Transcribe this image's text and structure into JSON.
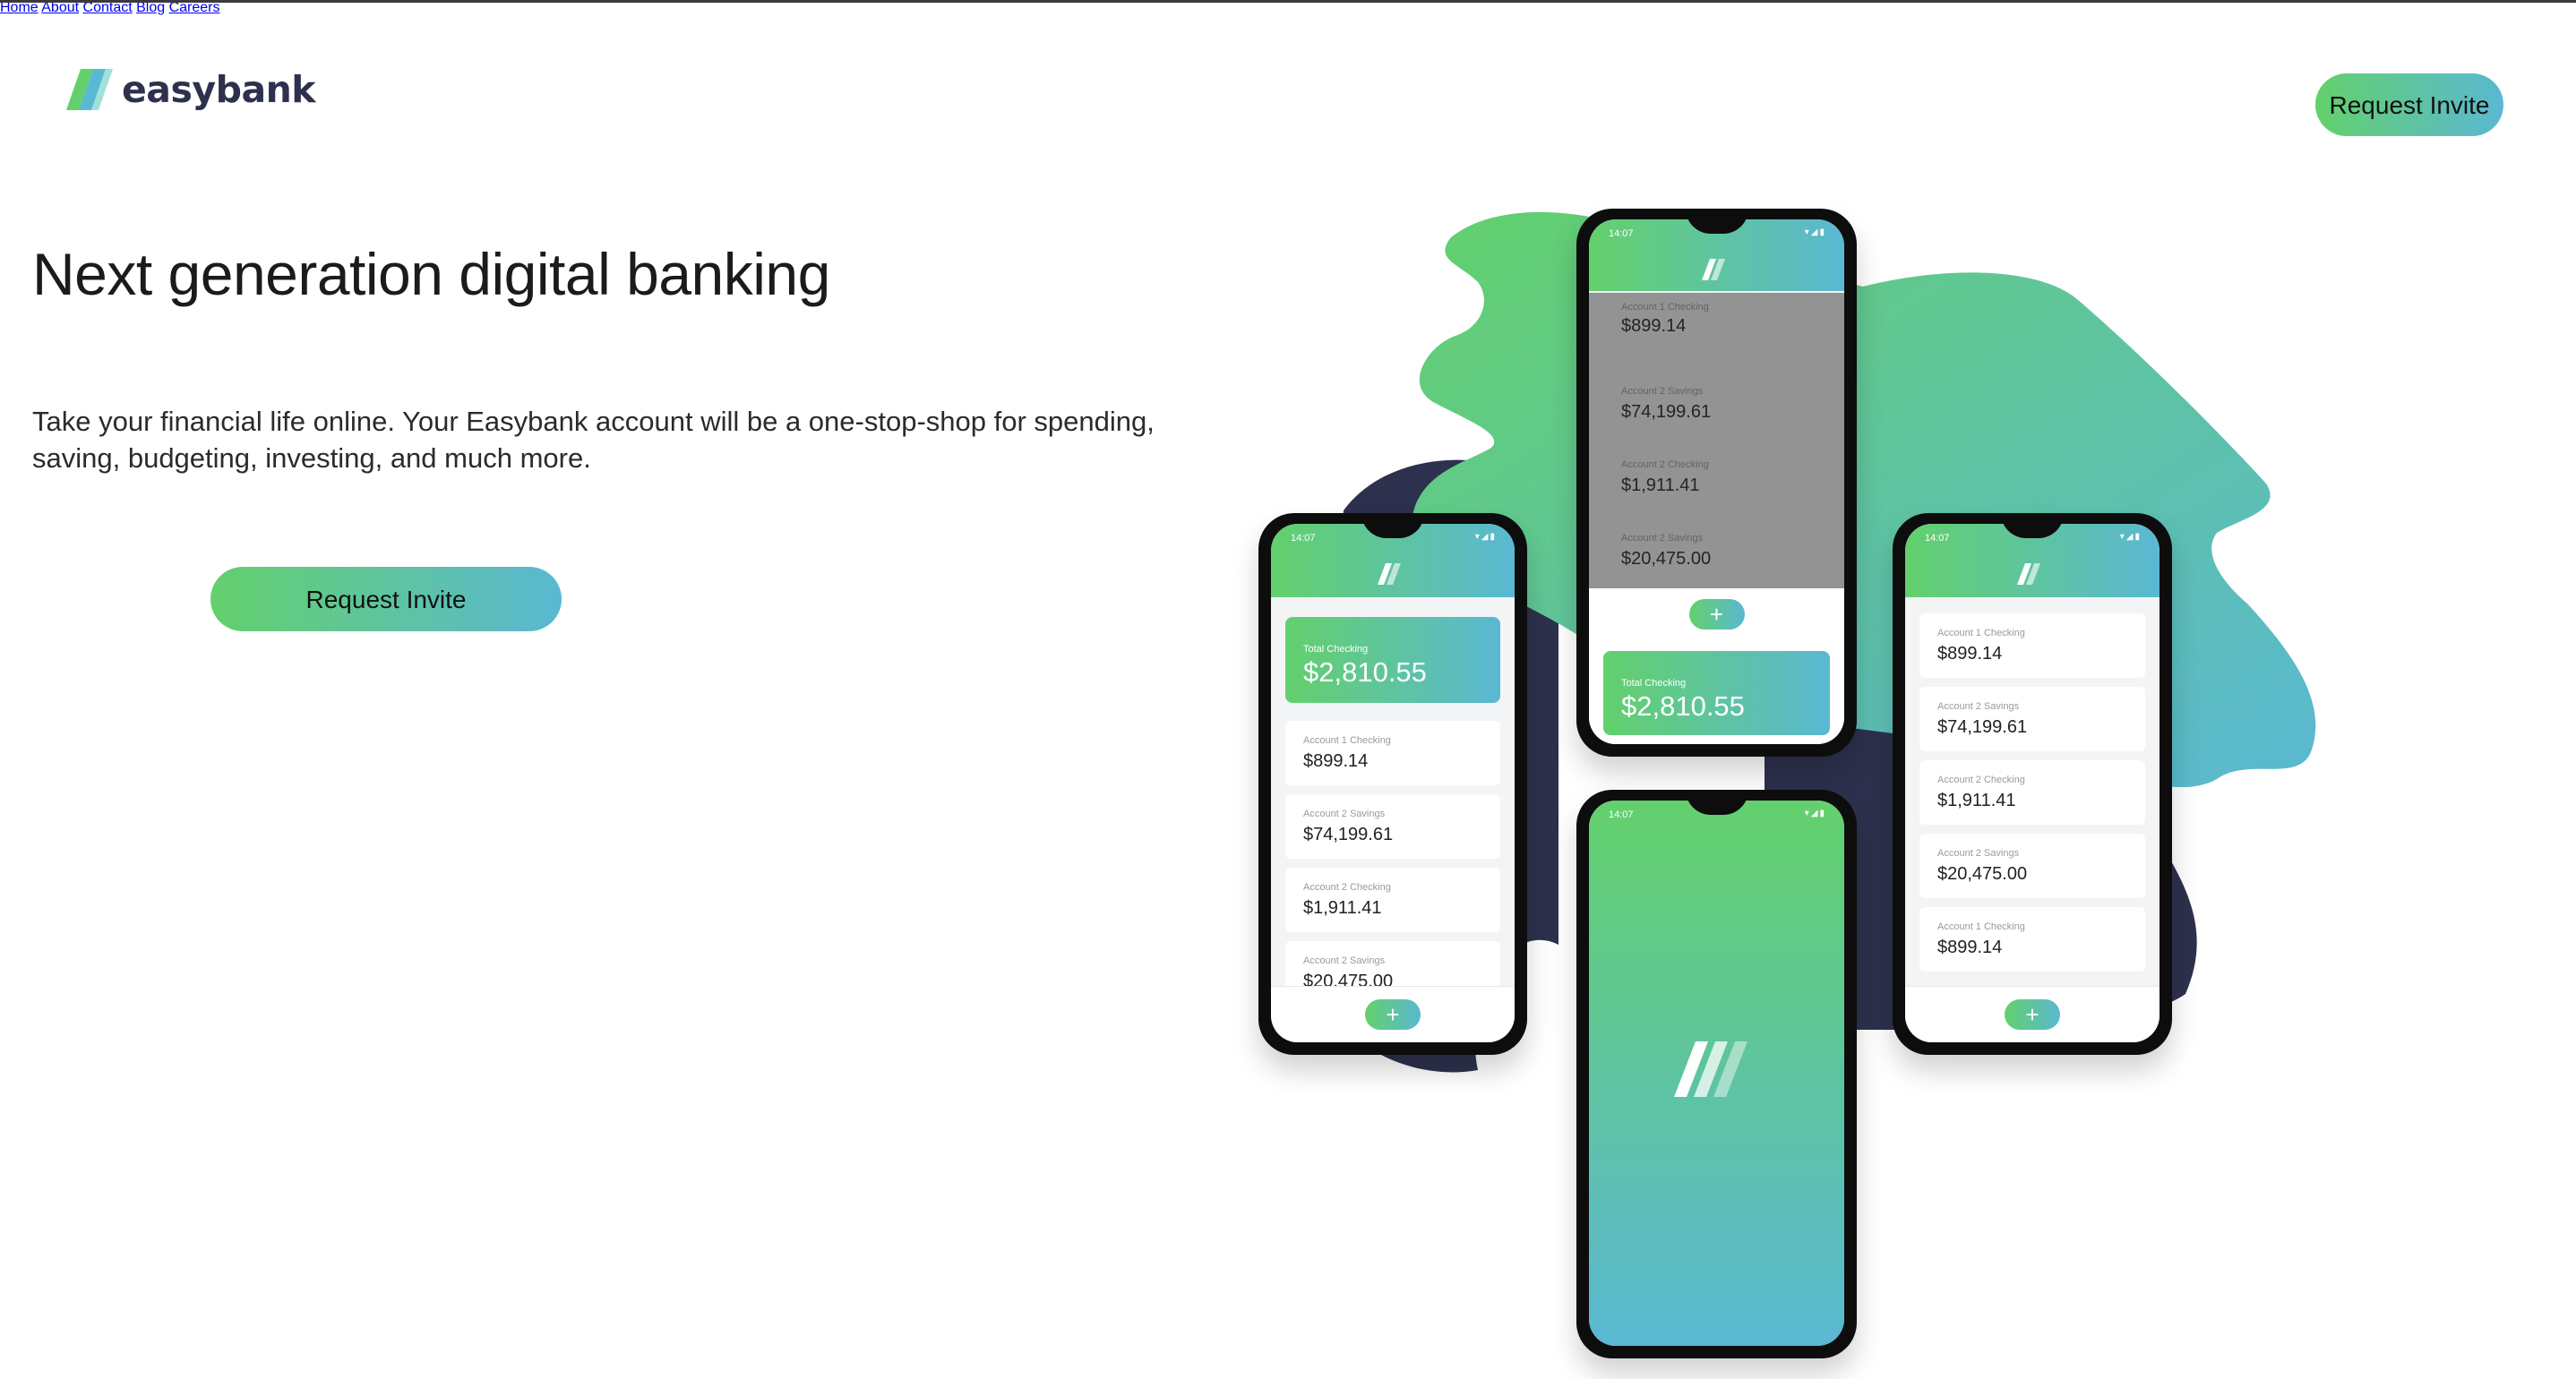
{
  "brand": {
    "name": "easybank",
    "logo_icon": "easybank-slash-icon"
  },
  "nav": {
    "items": [
      {
        "label": "Home"
      },
      {
        "label": "About"
      },
      {
        "label": "Contact"
      },
      {
        "label": "Blog"
      },
      {
        "label": "Careers"
      }
    ],
    "cta_label": "Request Invite"
  },
  "hero": {
    "title": "Next generation digital banking",
    "description": "Take your financial life online. Your Easybank account will be a one-stop-shop for spending, saving, budgeting, investing, and much more.",
    "cta_label": "Request Invite"
  },
  "mockups": {
    "status_time": "14:07",
    "total_label": "Total Checking",
    "total_amount": "$2,810.55",
    "accounts": [
      {
        "label": "Account 1 Checking",
        "amount": "$899.14"
      },
      {
        "label": "Account 2 Savings",
        "amount": "$74,199.61"
      },
      {
        "label": "Account 2 Checking",
        "amount": "$1,911.41"
      },
      {
        "label": "Account 2 Savings",
        "amount": "$20,475.00"
      },
      {
        "label": "Account 1 Checking",
        "amount": "$899.14"
      }
    ],
    "add_symbol": "+"
  },
  "colors": {
    "brand_dark": "#2d314d",
    "gradient_start": "#63d06c",
    "gradient_end": "#5ab8d2",
    "nav_text": "#9698a6"
  }
}
